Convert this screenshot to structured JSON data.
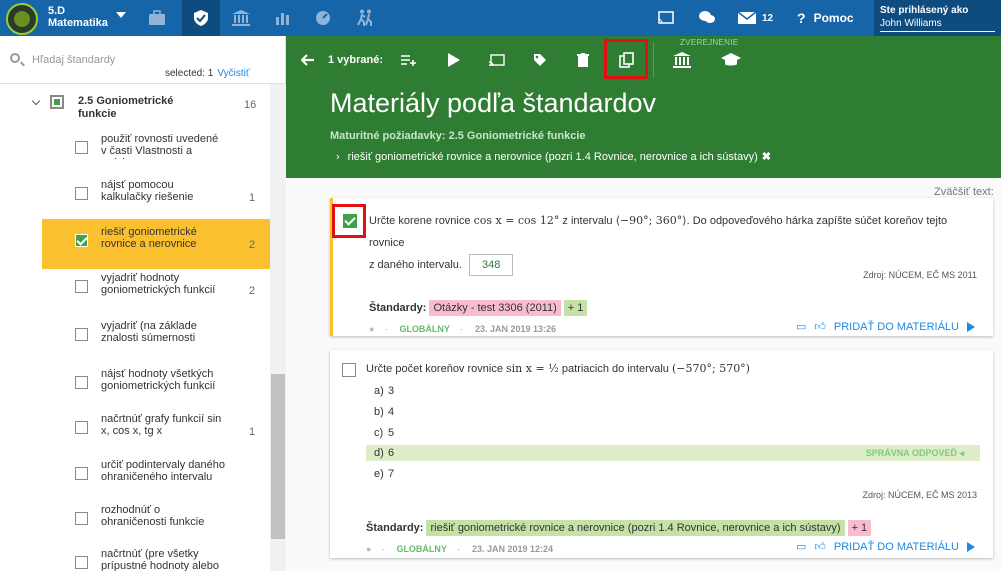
{
  "app": {
    "class_line1": "5.D",
    "class_line2": "Matematika",
    "messages_count": "12",
    "help_label": "Pomoc",
    "signed_in_label": "Ste prihlásený ako",
    "user_name": "John Williams",
    "nav_icons": [
      "briefcase-icon",
      "shield-icon",
      "institution-icon",
      "bar-chart-icon",
      "speedometer-icon",
      "walk-icon"
    ]
  },
  "sidebar": {
    "search_placeholder": "Hľadaj štandardy",
    "selected_label": "selected: 1",
    "clear_label": "Vyčistiť",
    "group": {
      "title": "2.5 Goniometrické funkcie",
      "count": "16"
    },
    "items": [
      {
        "label": "použiť rovnosti uvedené v časti Vlastnosti a vzťahy",
        "count": "",
        "selected": false
      },
      {
        "label": "nájsť pomocou kalkulačky riešenie",
        "count": "1",
        "selected": false
      },
      {
        "label": "riešiť goniometrické rovnice a nerovnice",
        "count": "2",
        "selected": true
      },
      {
        "label": "vyjadriť hodnoty goniometrických funkcií",
        "count": "2",
        "selected": false
      },
      {
        "label": "vyjadriť (na základe znalosti súmernosti",
        "count": "",
        "selected": false
      },
      {
        "label": "nájsť hodnoty všetkých goniometrických funkcií",
        "count": "",
        "selected": false
      },
      {
        "label": "načrtnúť grafy funkcií sin x, cos x, tg x",
        "count": "1",
        "selected": false
      },
      {
        "label": "určiť podintervaly daného ohraničeného intervalu",
        "count": "",
        "selected": false
      },
      {
        "label": "rozhodnúť o ohraničenosti funkcie",
        "count": "",
        "selected": false
      },
      {
        "label": "načrtnúť (pre všetky prípustné hodnoty alebo pre hodnoty z daného intervalu",
        "count": "",
        "selected": false
      }
    ]
  },
  "toolbar": {
    "selected_label": "1 vybrané:",
    "published_label": "ZVEREJNENIE"
  },
  "header": {
    "title": "Materiály podľa štandardov",
    "requirement": "Maturitné požiadavky: 2.5 Goniometrické funkcie",
    "breadcrumb": "riešiť goniometrické rovnice a nerovnice (pozri 1.4 Rovnice, nerovnice a ich sústavy)"
  },
  "main": {
    "zoom_label": "Zväčšiť text:",
    "q1": {
      "text_a": "Určte korene rovnice",
      "math_a": "cos x = cos 12°",
      "text_b": "z intervalu",
      "math_b": "⟨−90°; 360°⟩",
      "text_c": ". Do odpoveďového hárka zapíšte súčet koreňov tejto rovnice",
      "text_d": "z daného intervalu.",
      "answer": "348",
      "source": "Zdroj: NÚCEM, EČ MS 2011",
      "standards_label": "Štandardy:",
      "tag_main": "Otázky - test 3306 (2011)",
      "tag_more": "+ 1",
      "visibility": "GLOBÁLNY",
      "date": "23. JAN 2019 13:26",
      "add_label": "PRIDAŤ DO MATERIÁLU"
    },
    "q2": {
      "text_a": "Určte počet koreňov rovnice",
      "math_a": "sin x = ½",
      "text_b": "patriacich do intervalu",
      "math_b": "(−570°; 570°)",
      "options": [
        {
          "letter": "a)",
          "value": "3"
        },
        {
          "letter": "b)",
          "value": "4"
        },
        {
          "letter": "c)",
          "value": "5"
        },
        {
          "letter": "d)",
          "value": "6"
        },
        {
          "letter": "e)",
          "value": "7"
        }
      ],
      "correct_label": "SPRÁVNA ODPOVEĎ",
      "source": "Zdroj: NÚCEM, EČ MS 2013",
      "standards_label": "Štandardy:",
      "tag_main": "riešiť goniometrické rovnice a nerovnice (pozri 1.4 Rovnice, nerovnice a ich sústavy)",
      "tag_more": "+ 1",
      "visibility": "GLOBÁLNY",
      "date": "23. JAN 2019 12:24",
      "add_label": "PRIDAŤ DO MATERIÁLU"
    }
  }
}
